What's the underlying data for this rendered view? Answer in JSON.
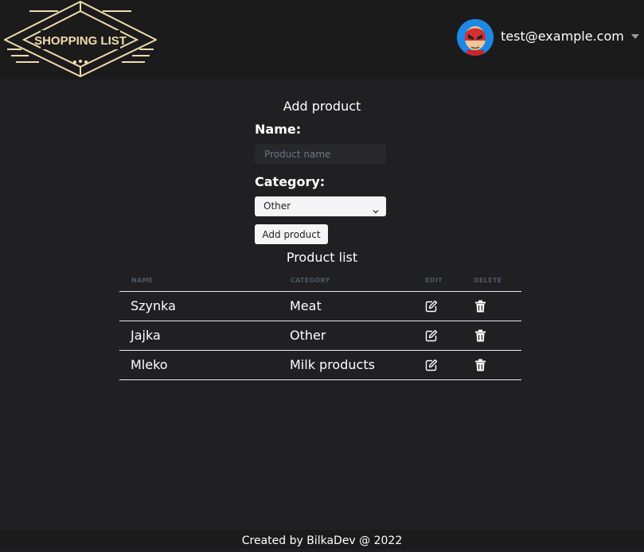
{
  "header": {
    "logo_text": "SHOPPING LIST",
    "user_email": "test@example.com"
  },
  "add_product": {
    "title": "Add product",
    "name_label": "Name:",
    "name_placeholder": "Product name",
    "name_value": "",
    "category_label": "Category:",
    "category_selected": "Other",
    "add_button_label": "Add product"
  },
  "product_list": {
    "title": "Product list",
    "columns": {
      "name": "NAME",
      "category": "CATEGORY",
      "edit": "EDIT",
      "delete": "DELETE"
    },
    "rows": [
      {
        "name": "Szynka",
        "category": "Meat"
      },
      {
        "name": "Jajka",
        "category": "Other"
      },
      {
        "name": "Mleko",
        "category": "Milk products"
      }
    ]
  },
  "footer": {
    "text": "Created by BilkaDev @ 2022"
  },
  "colors": {
    "background": "#202022",
    "header_background": "#1b1b1c",
    "logo_gold": "#f1dcae",
    "avatar_blue": "#1e88e5",
    "column_header": "#4f5669"
  },
  "icons": {
    "edit": "pencil-square-icon",
    "delete": "trash-icon",
    "select": "chevron-down-icon",
    "user_menu": "caret-down-icon"
  }
}
